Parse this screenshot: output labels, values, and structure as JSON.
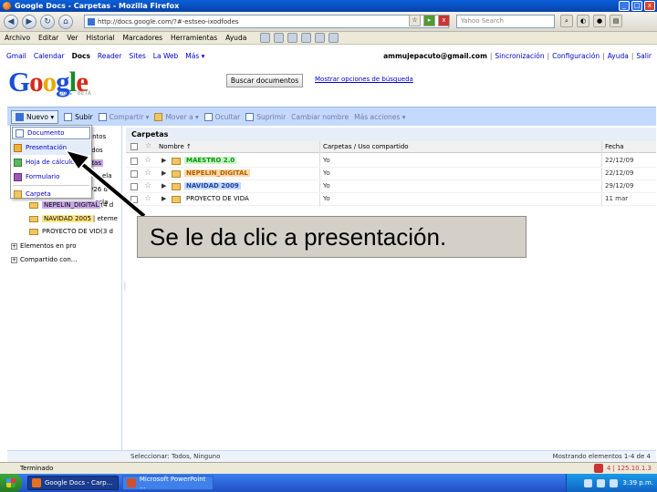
{
  "window": {
    "title": "Google Docs - Carpetas - Mozilla Firefox",
    "min": "_",
    "max": "□",
    "close": "x"
  },
  "navbar": {
    "url": "http://docs.google.com/?#-estseo-ixodfodes",
    "search_placeholder": "Yahoo Search"
  },
  "menubar": {
    "items": [
      "Archivo",
      "Editar",
      "Ver",
      "Historial",
      "Marcadores",
      "Herramientas",
      "Ayuda"
    ]
  },
  "gbar": {
    "links": [
      "Gmail",
      "Calendar",
      "Docs",
      "Reader",
      "Sites",
      "La Web",
      "Más ▾"
    ],
    "current_index": 2,
    "email": "ammujepacuto@gmail.com",
    "sep": "|",
    "right_links": [
      "Sincronización",
      "Configuración",
      "Ayuda",
      "Salir"
    ]
  },
  "logo": {
    "text": "Google",
    "sub": "Docs",
    "beta": "BETA"
  },
  "search": {
    "button": "Buscar documentos",
    "options": "Mostrar opciones de búsqueda"
  },
  "docsbar": {
    "nuevo": "Nuevo ▾",
    "subir": "Subir",
    "compartir": "Compartir ▾",
    "mover": "Mover a ▾",
    "ocultar": "Ocultar",
    "suprimir": "Suprimir",
    "cambiar": "Cambiar nombre",
    "mas": "Más acciones ▾"
  },
  "dropdown": {
    "items": [
      "Documento",
      "Presentación",
      "Hoja de cálculo",
      "Formulario",
      "Carpeta"
    ]
  },
  "leftpanel": {
    "rows": [
      {
        "text": "mentos",
        "tag": ""
      },
      {
        "text": "ados",
        "tag": ""
      },
      {
        "text": "atas",
        "tag": "purple"
      },
      {
        "text": "ela",
        "tag": ""
      },
      {
        "text": "/26 d",
        "tag": ""
      },
      {
        "text": "ecla",
        "tag": ""
      },
      {
        "text": "NEPELIN_DIGITAL",
        "suffix": " (4 d",
        "tag": "purple"
      },
      {
        "text": "NAVIDAD 2005",
        "suffix": " | eteme",
        "tag": "yellow"
      },
      {
        "text": "PROYECTO DE VID",
        "suffix": " (3 d",
        "tag": ""
      },
      {
        "text": "Elementos en pro",
        "suffix": "",
        "tag": ""
      },
      {
        "text": "Compartido con...",
        "suffix": "",
        "tag": ""
      }
    ]
  },
  "main": {
    "header": "Carpetas",
    "col_name": "Nombre ↑",
    "col_folders": "Carpetas / Uso compartido",
    "col_date": "Fecha",
    "rows": [
      {
        "name": "MAESTRO 2.0",
        "style": "green",
        "folders": "Yo",
        "date": "22/12/09"
      },
      {
        "name": "NEPELIN_DIGITAL",
        "style": "orange",
        "folders": "Yo",
        "date": "22/12/09"
      },
      {
        "name": "NAVIDAD 2009",
        "style": "blue",
        "folders": "Yo",
        "date": "29/12/09"
      },
      {
        "name": "PROYECTO DE VIDA",
        "style": "plain",
        "folders": "Yo",
        "date": "11 mar"
      }
    ]
  },
  "callout": {
    "text": "Se le da clic a presentación."
  },
  "footer": {
    "selected": "Seleccionar: Todos, Ninguno",
    "showing": "Mostrando elementos 1-4 de 4"
  },
  "statusbar": {
    "text": "Terminado",
    "ip": "4 | 125.10.1.3"
  },
  "taskbar": {
    "task1": "Google Docs - Carp...",
    "task2": "Microsoft PowerPoint ...",
    "time": "3:39 p.m."
  }
}
